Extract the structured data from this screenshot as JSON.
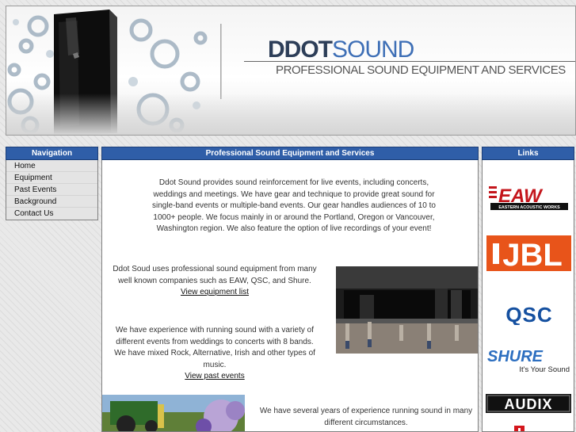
{
  "header": {
    "brand_part1": "DDOT",
    "brand_part2": "SOUND",
    "tagline": "PROFESSIONAL SOUND EQUIPMENT AND SERVICES"
  },
  "navigation": {
    "title": "Navigation",
    "items": [
      {
        "label": "Home"
      },
      {
        "label": "Equipment"
      },
      {
        "label": "Past Events"
      },
      {
        "label": "Background"
      },
      {
        "label": "Contact Us"
      }
    ]
  },
  "content": {
    "title": "Professional Sound Equipment and Services",
    "intro": "Ddot Sound provides sound reinforcement for live events, including concerts, weddings and meetings. We have gear and technique to provide great sound for single-band events or multiple-band events. Our gear handles audiences of 10 to 1000+ people. We focus mainly in or around the Portland, Oregon or Vancouver, Washington region. We also feature the option of live recordings of your event!",
    "equipment_text": "Ddot Soud uses professional sound equipment from many well known companies such as EAW, QSC, and Shure.",
    "equipment_link": "View equipment list",
    "events_text": "We have experience with running sound with a variety of different events from weddings to concerts with 8 bands. We have mixed Rock, Alternative, Irish and other types of music.",
    "events_link": "View past events",
    "background_text": "We have several years of experience running sound in many different circumstances."
  },
  "links": {
    "title": "Links",
    "logos": [
      {
        "name": "EAW",
        "sub": "EASTERN ACOUSTIC WORKS"
      },
      {
        "name": "JBL"
      },
      {
        "name": "QSC"
      },
      {
        "name": "SHURE",
        "sub": "It's Your Sound"
      },
      {
        "name": "AUDIX"
      }
    ]
  },
  "colors": {
    "panel_header": "#2f5ea8",
    "brand_dark": "#2d3e58",
    "brand_blue": "#3e6fb6",
    "jbl_orange": "#e8541a",
    "qsc_blue": "#1550a0",
    "shure_blue": "#2d6fc0"
  }
}
